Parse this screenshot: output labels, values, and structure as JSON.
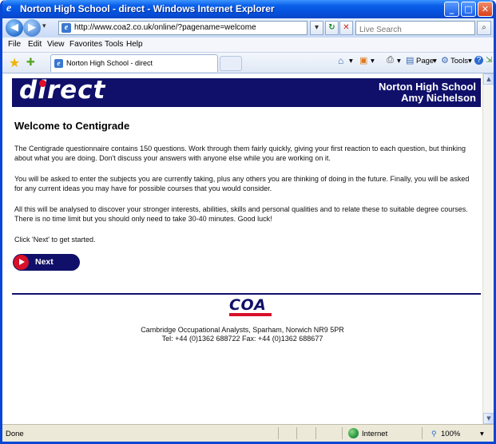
{
  "window": {
    "title": "Norton High School - direct - Windows Internet Explorer",
    "controls": [
      "minimize",
      "maximize",
      "close"
    ]
  },
  "navbar": {
    "url": "http://www.coa2.co.uk/online/?pagename=welcome",
    "search_placeholder": "Live Search"
  },
  "menubar": {
    "items": [
      "File",
      "Edit",
      "View",
      "Favorites",
      "Tools",
      "Help"
    ]
  },
  "tab": {
    "title": "Norton High School - direct"
  },
  "commandbar": {
    "page_label": "Page",
    "tools_label": "Tools"
  },
  "page": {
    "banner": {
      "logo_text": "direct",
      "school_name": "Norton High School",
      "student_name": "Amy Nichelson"
    },
    "heading": "Welcome to Centigrade",
    "paragraphs": [
      "The Centigrade questionnaire contains 150 questions. Work through them fairly quickly, giving your first reaction to each question, but thinking about what you are doing. Don't discuss your answers with anyone else while you are working on it.",
      "You will be asked to enter the subjects you are currently taking, plus any others you are thinking of doing in the future. Finally, you will be asked for any current ideas you may have for possible courses that you would consider.",
      "All this will be analysed to discover your stronger interests, abilities, skills and personal qualities and to relate these to suitable degree courses. There is no time limit but you should only need to take 30-40 minutes. Good luck!",
      "Click 'Next' to get started."
    ],
    "next_label": "Next",
    "footer_logo": "COA",
    "footer_address": "Cambridge Occupational Analysts, Sparham, Norwich NR9 5PR",
    "footer_contact": "Tel: +44 (0)1362 688722   Fax: +44 (0)1362 688677"
  },
  "statusbar": {
    "status": "Done",
    "zone": "Internet",
    "zoom": "100%"
  }
}
